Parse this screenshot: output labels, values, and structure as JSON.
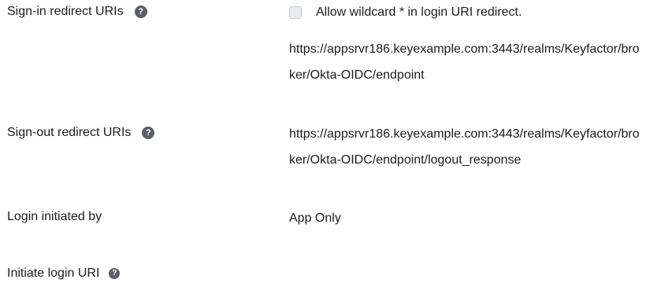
{
  "rows": {
    "signin": {
      "label": "Sign-in redirect URIs",
      "help_icon": "question-circle-icon",
      "wildcard_label": "Allow wildcard * in login URI redirect.",
      "wildcard_checked": false,
      "uri": "https://appsrvr186.keyexample.com:3443/realms/Keyfactor/broker/Okta-OIDC/endpoint"
    },
    "signout": {
      "label": "Sign-out redirect URIs",
      "help_icon": "question-circle-icon",
      "uri": "https://appsrvr186.keyexample.com:3443/realms/Keyfactor/broker/Okta-OIDC/endpoint/logout_response"
    },
    "login_initiated": {
      "label": "Login initiated by",
      "value": "App Only"
    },
    "initiate_login_uri": {
      "label": "Initiate login URI",
      "help_icon": "question-circle-icon"
    }
  }
}
